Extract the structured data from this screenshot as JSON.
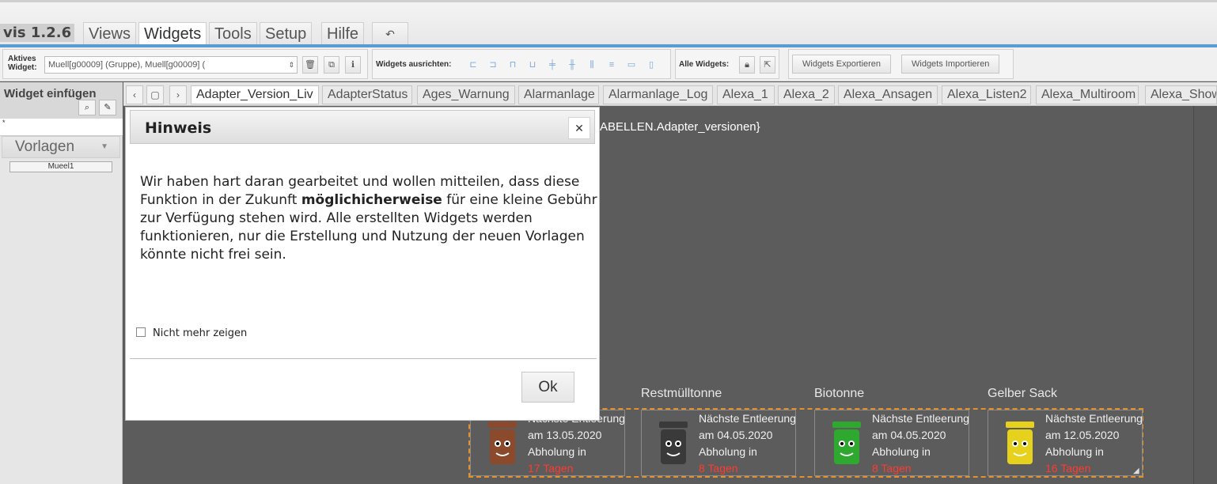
{
  "menubar": {
    "app_title": "vis 1.2.6",
    "tabs": [
      "Views",
      "Widgets",
      "Tools",
      "Setup",
      "Hilfe"
    ],
    "active_tab": "Widgets",
    "undo_icon": "undo-icon"
  },
  "toolbar": {
    "active_widget_label_1": "Aktives",
    "active_widget_label_2": "Widget:",
    "active_widget_value": "Muell[g00009] (Gruppe), Muell[g00009] (",
    "align_label": "Widgets ausrichten:",
    "all_widgets_label": "Alle Widgets:",
    "export_label": "Widgets Exportieren",
    "import_label": "Widgets Importieren"
  },
  "leftpanel": {
    "title": "Widget einfügen",
    "filter_value": "*",
    "vorlagen_label": "Vorlagen",
    "template_item": "Mueel1"
  },
  "viewtabs": [
    "Adapter_Version_Liv",
    "AdapterStatus",
    "Ages_Warnung",
    "Alarmanlage",
    "Alarmanlage_Log",
    "Alexa_1",
    "Alexa_2",
    "Alexa_Ansagen",
    "Alexa_Listen2",
    "Alexa_Multiroom",
    "Alexa_Show"
  ],
  "canvas": {
    "bound_text": "ABELLEN.Adapter_versionen}",
    "bins": [
      {
        "title": "",
        "line1": "Nächste Entleerung",
        "date": "am 13.05.2020",
        "pickup": "Abholung in",
        "days": "17 Tagen",
        "color": "#8b4a2b"
      },
      {
        "title": "Restmülltonne",
        "line1": "Nächste Entleerung",
        "date": "am 04.05.2020",
        "pickup": "Abholung in",
        "days": "8 Tagen",
        "color": "#3a3a3a"
      },
      {
        "title": "Biotonne",
        "line1": "Nächste Entleerung",
        "date": "am 04.05.2020",
        "pickup": "Abholung in",
        "days": "8 Tagen",
        "color": "#2ea82e"
      },
      {
        "title": "Gelber Sack",
        "line1": "Nächste Entleerung",
        "date": "am 12.05.2020",
        "pickup": "Abholung in",
        "days": "16 Tagen",
        "color": "#e6d21c"
      }
    ]
  },
  "dialog": {
    "title": "Hinweis",
    "body_pre": "Wir haben hart daran gearbeitet und wollen mitteilen, dass diese Funktion in der Zukunft ",
    "body_bold": "möglichicherweise",
    "body_post": " für eine kleine Gebühr zur Verfügung stehen wird. Alle erstellten Widgets werden funktionieren, nur die Erstellung und Nutzung der neuen Vorlagen könnte nicht frei sein.",
    "checkbox_label": "Nicht mehr zeigen",
    "ok_label": "Ok"
  }
}
